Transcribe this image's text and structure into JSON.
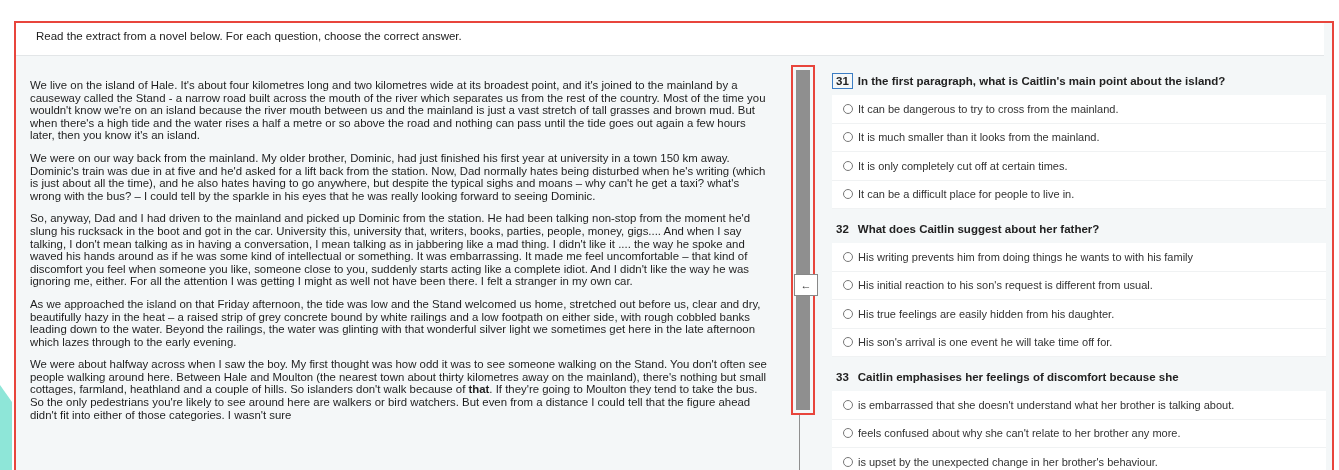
{
  "instruction": "Read the extract from a novel below. For each question, choose the correct answer.",
  "passage": [
    "We live on the island of Hale. It's about four kilometres long and two kilometres wide at its broadest point, and it's joined to the mainland by a causeway called the Stand - a narrow road built across the mouth of the river which separates us from the rest of the country. Most of the time you wouldn't know we're on an island because the river mouth between us and the mainland is just a vast stretch of tall grasses and brown mud. But when there's a high tide and the water rises a half a metre or so above the road and nothing can pass until the tide goes out again a few hours later, then you know it's an island.",
    "We were on our way back from the mainland. My older brother, Dominic, had just finished his first year at university in a town 150 km away. Dominic's train was due in at five and he'd asked for a lift back from the station. Now, Dad normally hates being disturbed when he's writing (which is just about all the time), and he also hates having to go anywhere, but despite the typical sighs and moans – why can't he get a taxi? what's wrong with the bus? – I could tell by the sparkle in his eyes that he was really looking forward to seeing Dominic.",
    "So, anyway, Dad and I had driven to the mainland and picked up Dominic from the station. He had been talking non-stop from the moment he'd slung his rucksack in the boot and got in the car. University this, university that, writers, books, parties, people, money, gigs.... And when I say talking, I don't mean talking as in having a conversation, I mean talking as in jabbering like a mad thing. I didn't like it .... the way he spoke and waved his hands around as if he was some kind of intellectual or something. It was embarrassing. It made me feel uncomfortable – that kind of discomfort you feel when someone you like, someone close to you, suddenly starts acting like a complete idiot. And I didn't like the way he was ignoring me, either. For all the attention I was getting I might as well not have been there. I felt a stranger in my own car.",
    "As we approached the island on that Friday afternoon, the tide was low and the Stand welcomed us home, stretched out before us, clear and dry, beautifully hazy in the heat – a raised strip of grey concrete bound by white railings and a low footpath on either side, with rough cobbled banks leading down to the water. Beyond the railings, the water was glinting with that wonderful silver light we sometimes get here in the late afternoon which lazes through to the early evening.",
    "We were about halfway across when I saw the boy. My first thought was how odd it was to see someone walking on the Stand. You don't often see people walking around here. Between Hale and Moulton (the nearest town about thirty kilometres away on the mainland), there's nothing but small cottages, farmland, heathland and a couple of hills. So islanders don't walk because of **that**. If they're going to Moulton they tend to take the bus. So the only pedestrians you're likely to see around here are walkers or bird watchers. But even from a distance I could tell that the figure ahead didn't fit into either of those categories. I wasn't sure"
  ],
  "divider_handle": "←",
  "questions": [
    {
      "number": "31",
      "current": true,
      "text": "In the first paragraph, what is Caitlin's main point about the island?",
      "options": [
        {
          "text": "It can be dangerous to try to cross from the mainland.",
          "selected": false
        },
        {
          "text": "It is much smaller than it looks from the mainland.",
          "selected": false
        },
        {
          "text": "It is only completely cut off at certain times.",
          "selected": false
        },
        {
          "text": "It can be a difficult place for people to live in.",
          "selected": false
        }
      ]
    },
    {
      "number": "32",
      "current": false,
      "text": "What does Caitlin suggest about her father?",
      "options": [
        {
          "text": "His writing prevents him from doing things he wants to with his family",
          "selected": false
        },
        {
          "text": "His initial reaction to his son's request is different from usual.",
          "selected": false
        },
        {
          "text": "His true feelings are easily hidden from his daughter.",
          "selected": false
        },
        {
          "text": "His son's arrival is one event he will take time off for.",
          "selected": false
        }
      ]
    },
    {
      "number": "33",
      "current": false,
      "text": "Caitlin emphasises her feelings of discomfort because she",
      "options": [
        {
          "text": "is embarrassed that she doesn't understand what her brother is talking about.",
          "selected": false
        },
        {
          "text": "feels confused about why she can't relate to her brother any more.",
          "selected": false
        },
        {
          "text": "is upset by the unexpected change in her brother's behaviour.",
          "selected": false
        }
      ]
    }
  ]
}
